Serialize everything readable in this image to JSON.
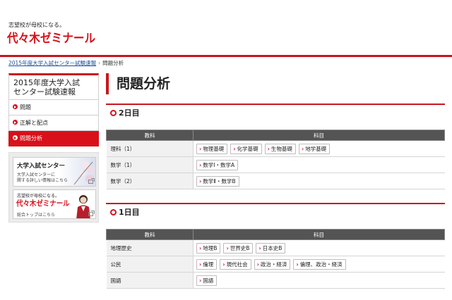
{
  "header": {
    "tagline": "志望校が母校になる。",
    "logo_text": "代々木ゼミナール"
  },
  "breadcrumb": {
    "parent_link": "2015年度大学入試センター試験速報",
    "current": "問題分析"
  },
  "sidebar": {
    "title_line1": "2015年度大学入試",
    "title_line2": "センター試験速報",
    "items": [
      {
        "label": "問題",
        "active": false
      },
      {
        "label": "正解と配点",
        "active": false
      },
      {
        "label": "問題分析",
        "active": true
      }
    ],
    "banner1": {
      "title": "大学入試センター",
      "line1": "大学入試センターに",
      "line2": "関する詳しい情報はこちら"
    },
    "banner2": {
      "tagline": "志望校が母校になる。",
      "logo": "代々木ゼミナール",
      "text": "総合トップはこちら"
    }
  },
  "main": {
    "page_title": "問題分析",
    "table_headers": {
      "category": "教科",
      "subjects": "科目"
    },
    "days": [
      {
        "label": "2日目",
        "rows": [
          {
            "category": "理科（1）",
            "subjects": [
              "物理基礎",
              "化学基礎",
              "生物基礎",
              "地学基礎"
            ]
          },
          {
            "category": "数学（1）",
            "subjects": [
              "数学Ⅰ・数学A"
            ]
          },
          {
            "category": "数学（2）",
            "subjects": [
              "数学Ⅱ・数学B"
            ]
          }
        ]
      },
      {
        "label": "1日目",
        "rows": [
          {
            "category": "地理歴史",
            "subjects": [
              "地理B",
              "世界史B",
              "日本史B"
            ]
          },
          {
            "category": "公民",
            "subjects": [
              "倫理",
              "現代社会",
              "政治・経済",
              "倫理、政治・経済"
            ]
          },
          {
            "category": "国語",
            "subjects": [
              "国語"
            ]
          }
        ]
      }
    ]
  },
  "colors": {
    "accent": "#c8161d",
    "header_bg": "#545454",
    "category_bg": "#f1f1f1"
  }
}
